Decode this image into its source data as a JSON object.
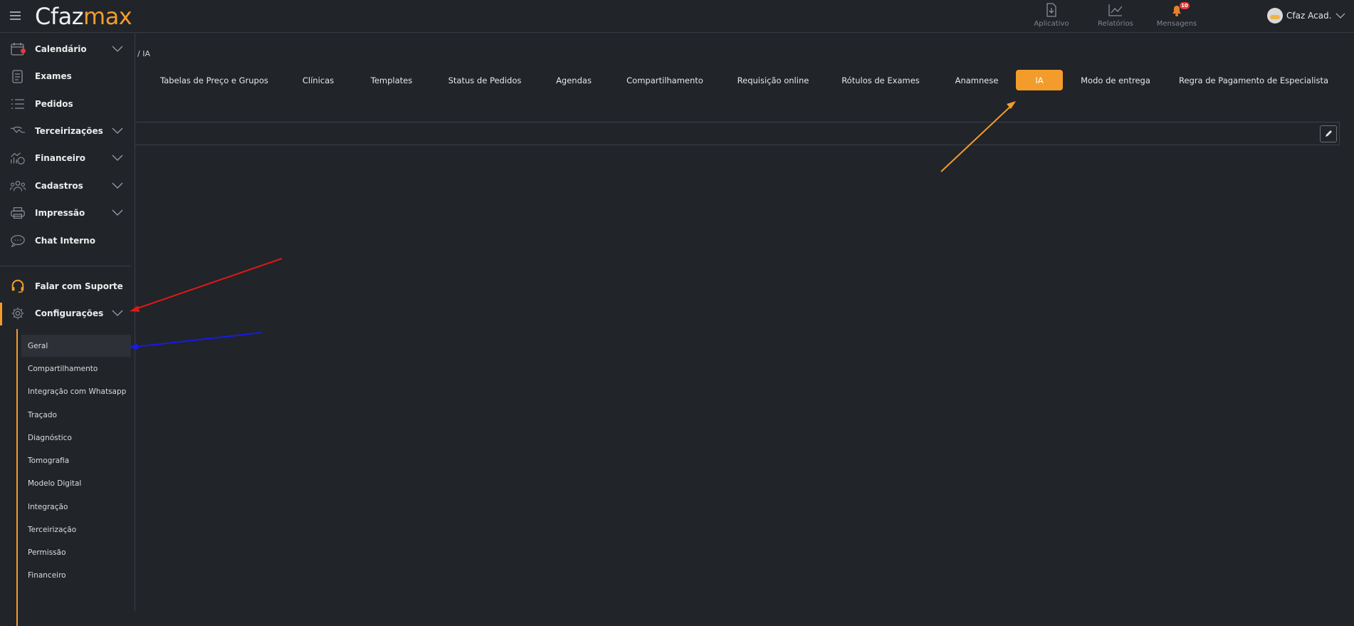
{
  "app": {
    "logo_left": "Cfaz",
    "logo_right": "max",
    "brand_color": "#f39c2b"
  },
  "topnav": [
    {
      "label": "Aplicativo",
      "icon": "download-file-icon"
    },
    {
      "label": "Relatórios",
      "icon": "chart-trend-icon"
    },
    {
      "label": "Mensagens",
      "icon": "bell-icon",
      "badge": "10"
    }
  ],
  "user": {
    "name": "Cfaz Acad."
  },
  "sidebar": {
    "items": [
      {
        "label": "Calendário",
        "icon": "calendar-icon",
        "expandable": true
      },
      {
        "label": "Exames",
        "icon": "clipboard-icon",
        "expandable": false
      },
      {
        "label": "Pedidos",
        "icon": "list-icon",
        "expandable": false
      },
      {
        "label": "Terceirizações",
        "icon": "handshake-icon",
        "expandable": true
      },
      {
        "label": "Financeiro",
        "icon": "finance-chart-icon",
        "expandable": true
      },
      {
        "label": "Cadastros",
        "icon": "users-icon",
        "expandable": true
      },
      {
        "label": "Impressão",
        "icon": "printer-icon",
        "expandable": true
      },
      {
        "label": "Chat Interno",
        "icon": "chat-icon",
        "expandable": false
      }
    ],
    "support": {
      "label": "Falar com Suporte",
      "icon": "headset-icon"
    },
    "settings": {
      "label": "Configurações",
      "icon": "gear-icon",
      "sub_items": [
        "Geral",
        "Compartilhamento",
        "Integração com Whatsapp",
        "Traçado",
        "Diagnóstico",
        "Tomografia",
        "Modelo Digital",
        "Integração",
        "Terceirização",
        "Permissão",
        "Financeiro"
      ],
      "selected": "Geral"
    }
  },
  "breadcrumb": "/  IA",
  "tabs": [
    "Tabelas de Preço e Grupos",
    "Clínicas",
    "Templates",
    "Status de Pedidos",
    "Agendas",
    "Compartilhamento",
    "Requisição online",
    "Rótulos de Exames",
    "Anamnese",
    "IA",
    "Modo de entrega",
    "Regra de Pagamento de Especialista"
  ],
  "active_tab": "IA",
  "annotations": {
    "colors": {
      "orange": "#f39c2b",
      "red": "#e01818",
      "blue": "#1a1ae6"
    }
  }
}
